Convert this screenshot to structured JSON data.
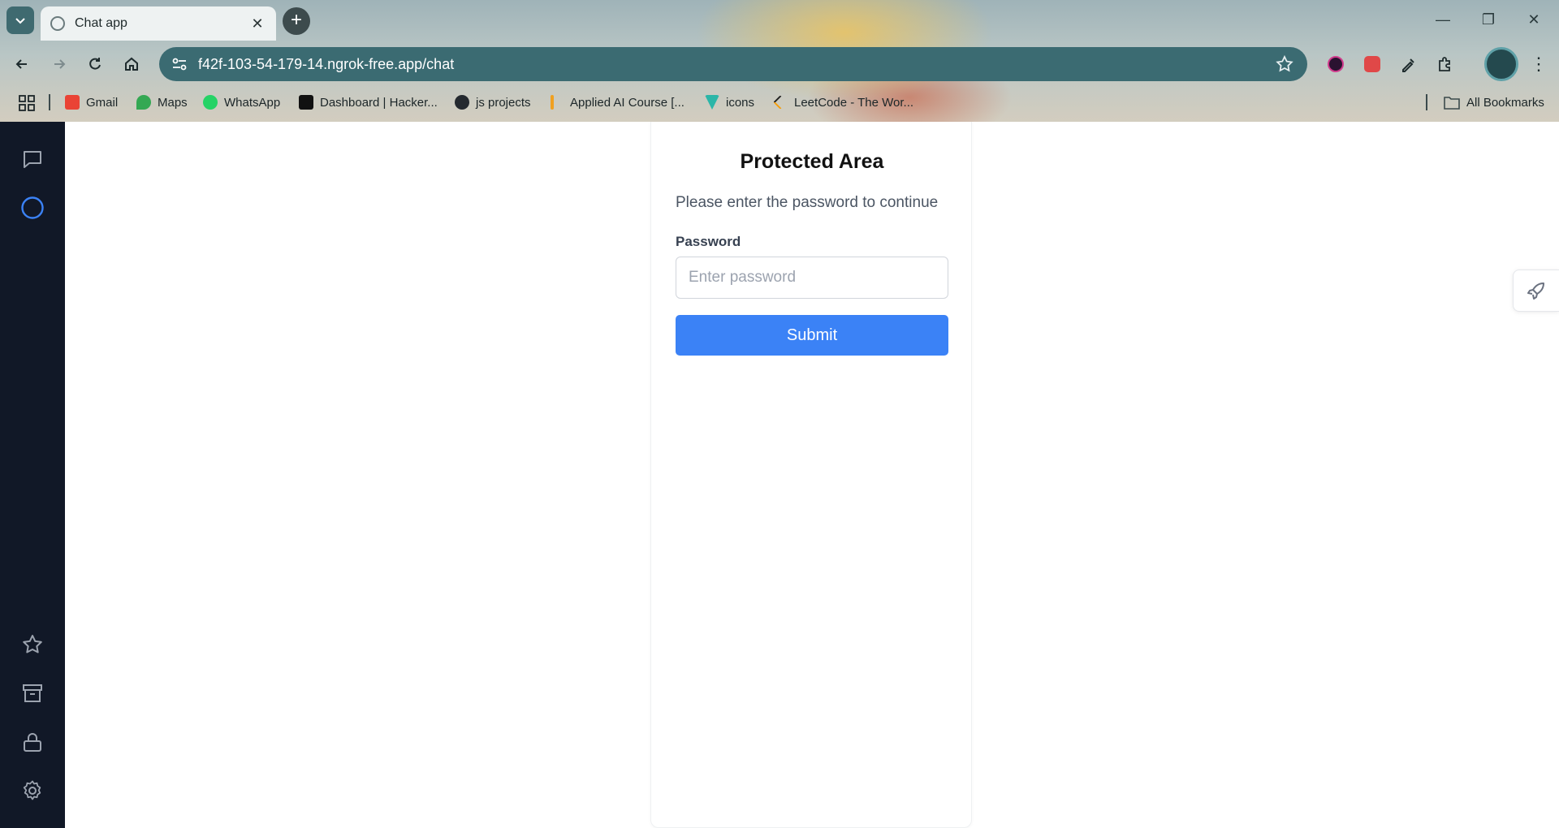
{
  "browser": {
    "tab": {
      "title": "Chat app",
      "favicon_icon": "globe-icon"
    },
    "address_bar": {
      "url": "f42f-103-54-179-14.ngrok-free.app/chat"
    },
    "bookmarks": [
      {
        "label": "Gmail",
        "icon": "gmail-icon",
        "color": "#ea4335"
      },
      {
        "label": "Maps",
        "icon": "maps-icon",
        "color": "#34a853"
      },
      {
        "label": "WhatsApp",
        "icon": "whatsapp-icon",
        "color": "#25d366"
      },
      {
        "label": "Dashboard | Hacker...",
        "icon": "hackerrank-icon",
        "color": "#111111"
      },
      {
        "label": "js projects",
        "icon": "github-icon",
        "color": "#24292f"
      },
      {
        "label": "Applied AI Course [...",
        "icon": "bookmark-icon",
        "color": "#f0a020"
      },
      {
        "label": "icons",
        "icon": "icons-site-icon",
        "color": "#2bb6a8"
      },
      {
        "label": "LeetCode - The Wor...",
        "icon": "leetcode-icon",
        "color": "#222222"
      }
    ],
    "all_bookmarks_label": "All Bookmarks"
  },
  "sidebar": {
    "items_top": [
      {
        "icon": "chat-icon"
      },
      {
        "icon": "circle-icon"
      }
    ],
    "items_bottom": [
      {
        "icon": "star-icon"
      },
      {
        "icon": "archive-icon"
      },
      {
        "icon": "lock-icon"
      },
      {
        "icon": "gear-icon"
      }
    ]
  },
  "login": {
    "title": "Protected Area",
    "subtitle": "Please enter the password to continue",
    "password_label": "Password",
    "password_placeholder": "Enter password",
    "password_value": "",
    "submit_label": "Submit"
  },
  "colors": {
    "sidebar_bg": "#111827",
    "accent": "#3b82f6",
    "circle_accent": "#3b82f6"
  }
}
